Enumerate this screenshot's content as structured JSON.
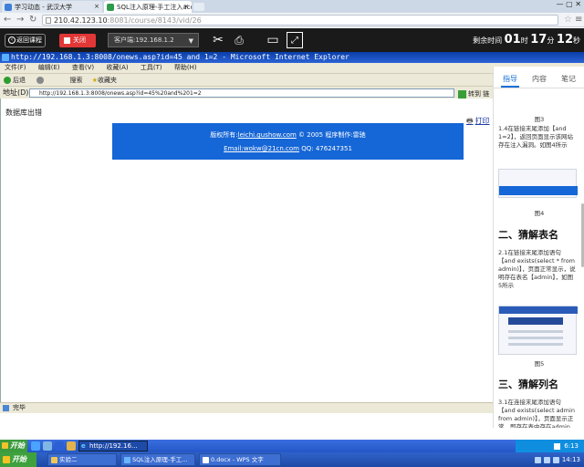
{
  "chrome": {
    "tabs": [
      {
        "label": "学习动态 - 武汉大学"
      },
      {
        "label": "SQL注入原理-手工注入acc"
      }
    ],
    "address_host": "210.42.123.10",
    "address_path": ":8081/course/8143/vid/26"
  },
  "exam_bar": {
    "back_label": "返回课程",
    "close_label": "关闭",
    "client_select": "客户端:192.168.1.2",
    "timer_label": "剩余时间",
    "timer_hours": "01",
    "hour_unit": "时",
    "timer_minutes": "17",
    "minute_unit": "分",
    "timer_seconds": "12",
    "second_unit": "秒"
  },
  "ie": {
    "title": "http://192.168.1.3:8008/onews.asp?id=45 and 1=2 - Microsoft Internet Explorer",
    "menu": [
      "文件(F)",
      "编辑(E)",
      "查看(V)",
      "收藏(A)",
      "工具(T)",
      "帮助(H)"
    ],
    "toolbar": {
      "back": "后退",
      "search": "搜索",
      "favorites": "收藏夹"
    },
    "address_label": "地址(D)",
    "address_value": "http://192.168.1.3:8008/onews.asp?id=45%20and%201=2",
    "go_label": "转到",
    "links_label": "链",
    "page_error": "数据库出错",
    "print_label": "打印",
    "footer_line1_prefix": "版权所有:",
    "footer_link1": "leichi.gushow.com",
    "footer_year": "2005",
    "footer_author": "程序制作:雷驰",
    "footer_email": "Email:wokw@21cn.com",
    "footer_qq": "QQ: 476247351",
    "status": "完毕"
  },
  "guide": {
    "tabs": [
      "指导",
      "内容",
      "笔记"
    ],
    "fig3_caption": "图3",
    "para1": "1.4在链接末尾添加【and 1=2】，返回页面显示该网站存在注入漏洞。如图4所示",
    "fig4_caption": "图4",
    "heading2": "二、猜解表名",
    "para2": "2.1在链接末尾添加语句【and exists(select * from admin)】，页面正常显示，说明存在表名【admin】，如图5所示",
    "fig5_caption": "图5",
    "heading3": "三、猜解列名",
    "para3": "3.1在连接末尾添加语句【and exists(select admin from admin)】，页面显示正常，即存在表中存在admin"
  },
  "xp_taskbar": {
    "start": "开始",
    "ie_task": "http://192.16...",
    "time": "6:13"
  },
  "win7_taskbar": {
    "start": "开始",
    "tasks": [
      "实验二",
      "SQL注入原理-手工...",
      "0.docx - WPS 文字"
    ],
    "time": "14:13"
  }
}
